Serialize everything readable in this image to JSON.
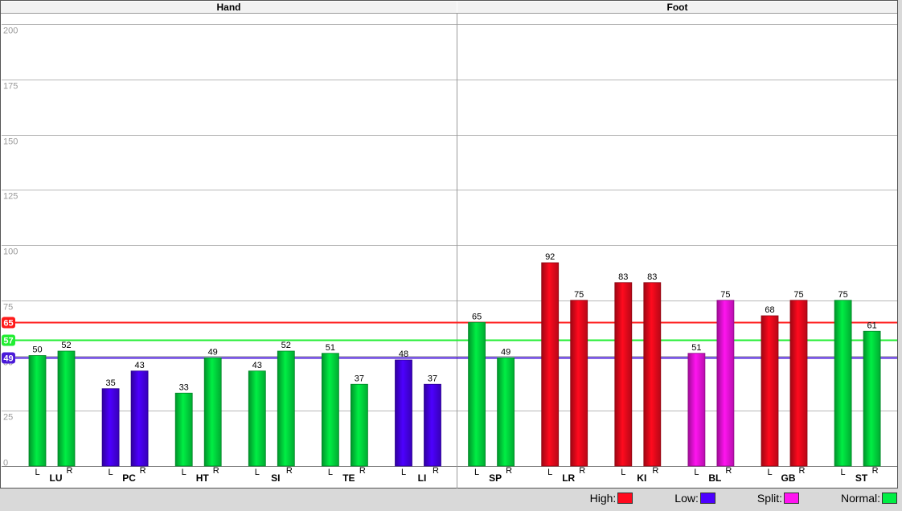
{
  "chart_data": {
    "type": "bar",
    "panels": [
      "Hand",
      "Foot"
    ],
    "ylim": [
      0,
      200
    ],
    "yticks": [
      0,
      25,
      50,
      75,
      100,
      125,
      150,
      175,
      200
    ],
    "groups": [
      {
        "label": "LU",
        "panel": "Hand",
        "bars": [
          {
            "side": "L",
            "value": 50,
            "status": "normal"
          },
          {
            "side": "R",
            "value": 52,
            "status": "normal"
          }
        ]
      },
      {
        "label": "PC",
        "panel": "Hand",
        "bars": [
          {
            "side": "L",
            "value": 35,
            "status": "low"
          },
          {
            "side": "R",
            "value": 43,
            "status": "low"
          }
        ]
      },
      {
        "label": "HT",
        "panel": "Hand",
        "bars": [
          {
            "side": "L",
            "value": 33,
            "status": "normal"
          },
          {
            "side": "R",
            "value": 49,
            "status": "normal"
          }
        ]
      },
      {
        "label": "SI",
        "panel": "Hand",
        "bars": [
          {
            "side": "L",
            "value": 43,
            "status": "normal"
          },
          {
            "side": "R",
            "value": 52,
            "status": "normal"
          }
        ]
      },
      {
        "label": "TE",
        "panel": "Hand",
        "bars": [
          {
            "side": "L",
            "value": 51,
            "status": "normal"
          },
          {
            "side": "R",
            "value": 37,
            "status": "normal"
          }
        ]
      },
      {
        "label": "LI",
        "panel": "Hand",
        "bars": [
          {
            "side": "L",
            "value": 48,
            "status": "low"
          },
          {
            "side": "R",
            "value": 37,
            "status": "low"
          }
        ]
      },
      {
        "label": "SP",
        "panel": "Foot",
        "bars": [
          {
            "side": "L",
            "value": 65,
            "status": "normal"
          },
          {
            "side": "R",
            "value": 49,
            "status": "normal"
          }
        ]
      },
      {
        "label": "LR",
        "panel": "Foot",
        "bars": [
          {
            "side": "L",
            "value": 92,
            "status": "high"
          },
          {
            "side": "R",
            "value": 75,
            "status": "high"
          }
        ]
      },
      {
        "label": "KI",
        "panel": "Foot",
        "bars": [
          {
            "side": "L",
            "value": 83,
            "status": "high"
          },
          {
            "side": "R",
            "value": 83,
            "status": "high"
          }
        ]
      },
      {
        "label": "BL",
        "panel": "Foot",
        "bars": [
          {
            "side": "L",
            "value": 51,
            "status": "split"
          },
          {
            "side": "R",
            "value": 75,
            "status": "split"
          }
        ]
      },
      {
        "label": "GB",
        "panel": "Foot",
        "bars": [
          {
            "side": "L",
            "value": 68,
            "status": "high"
          },
          {
            "side": "R",
            "value": 75,
            "status": "high"
          }
        ]
      },
      {
        "label": "ST",
        "panel": "Foot",
        "bars": [
          {
            "side": "L",
            "value": 75,
            "status": "normal"
          },
          {
            "side": "R",
            "value": 61,
            "status": "normal"
          }
        ]
      }
    ],
    "reference_lines": [
      {
        "value": 65,
        "label": "65",
        "color": "#ff1a1a"
      },
      {
        "value": 57,
        "label": "57",
        "color": "#22ee33"
      },
      {
        "value": 49,
        "label": "49",
        "color": "#4a1ad8"
      }
    ],
    "colors": {
      "high": "#ff0a1e",
      "low": "#4d00ff",
      "split": "#ff14f0",
      "normal": "#00ee44"
    },
    "legend": [
      {
        "label": "High:",
        "status": "high"
      },
      {
        "label": "Low:",
        "status": "low"
      },
      {
        "label": "Split:",
        "status": "split"
      },
      {
        "label": "Normal:",
        "status": "normal"
      }
    ],
    "grid": true,
    "legend_position": "bottom-right"
  }
}
